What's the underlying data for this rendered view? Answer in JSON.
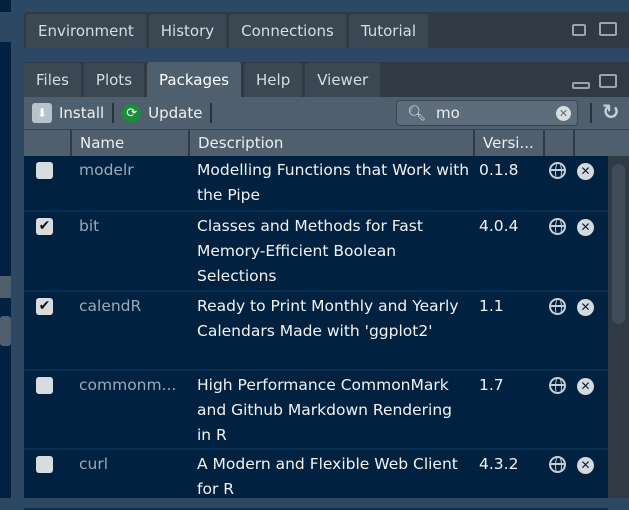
{
  "top_tabs": [
    "Environment",
    "History",
    "Connections",
    "Tutorial"
  ],
  "bottom_tabs": [
    "Files",
    "Plots",
    "Packages",
    "Help",
    "Viewer"
  ],
  "active_tab": "Packages",
  "toolbar": {
    "install": "Install",
    "update": "Update",
    "search_value": "mo",
    "search_placeholder": ""
  },
  "columns": {
    "name": "Name",
    "description": "Description",
    "version": "Versi..."
  },
  "packages": [
    {
      "name": "modelr",
      "description": "Modelling Functions that Work with the Pipe",
      "version": "0.1.8",
      "checked": false
    },
    {
      "name": "bit",
      "description": "Classes and Methods for Fast Memory-Efficient Boolean Selections",
      "version": "4.0.4",
      "checked": true
    },
    {
      "name": "calendR",
      "description": "Ready to Print Monthly and Yearly Calendars Made with 'ggplot2'",
      "version": "1.1",
      "checked": true
    },
    {
      "name": "commonm...",
      "description": "High Performance CommonMark and Github Markdown Rendering in R",
      "version": "1.7",
      "checked": false
    },
    {
      "name": "curl",
      "description": "A Modern and Flexible Web Client for R",
      "version": "4.3.2",
      "checked": false
    }
  ],
  "colors": {
    "table_bg": "#002240",
    "pane_bg": "#2f3a45",
    "header_bg": "#4f5f6e",
    "update_green": "#1a8c3a"
  }
}
